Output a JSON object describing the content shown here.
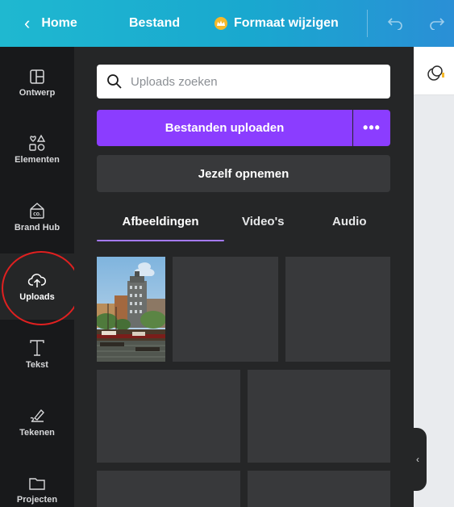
{
  "topbar": {
    "home_label": "Home",
    "file_label": "Bestand",
    "resize_label": "Formaat wijzigen",
    "undo_icon": "undo-icon",
    "redo_icon": "redo-icon",
    "crown_color": "#f6b92a"
  },
  "sidebar": {
    "items": [
      {
        "label": "Ontwerp",
        "icon": "layout-icon"
      },
      {
        "label": "Elementen",
        "icon": "shapes-icon"
      },
      {
        "label": "Brand Hub",
        "icon": "brand-hub-icon"
      },
      {
        "label": "Uploads",
        "icon": "cloud-upload-icon",
        "active": true
      },
      {
        "label": "Tekst",
        "icon": "text-icon"
      },
      {
        "label": "Tekenen",
        "icon": "draw-icon"
      },
      {
        "label": "Projecten",
        "icon": "folder-icon"
      }
    ]
  },
  "panel": {
    "search_placeholder": "Uploads zoeken",
    "upload_button": "Bestanden uploaden",
    "more_button": "•••",
    "record_button": "Jezelf opnemen",
    "tabs": [
      "Afbeeldingen",
      "Video's",
      "Audio"
    ],
    "active_tab": "Afbeeldingen"
  },
  "colors": {
    "accent": "#8b3dff",
    "panel_bg": "#252627",
    "rail_bg": "#18191b",
    "highlight": "#e02020"
  }
}
